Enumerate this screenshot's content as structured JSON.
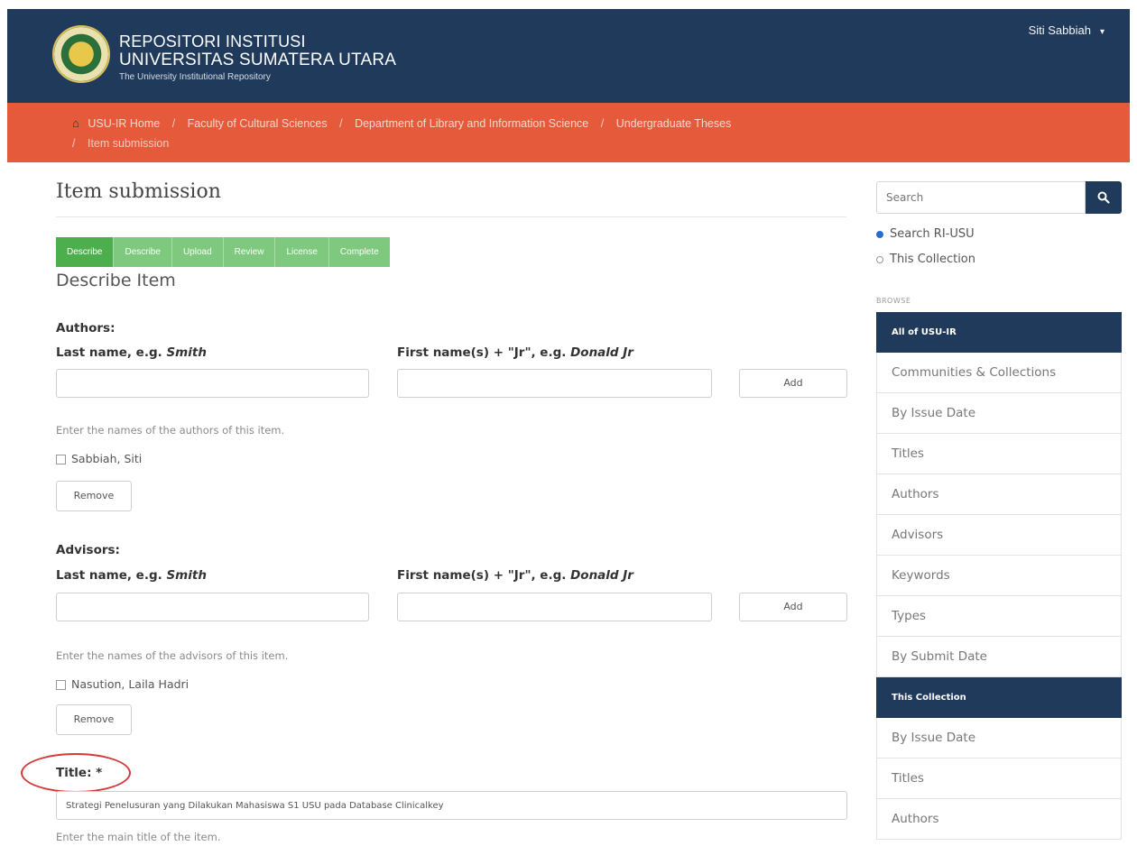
{
  "header": {
    "brand_line1": "REPOSITORI INSTITUSI",
    "brand_line2": "UNIVERSITAS SUMATERA UTARA",
    "brand_line3": "The University Institutional Repository",
    "user_name": "Siti Sabbiah",
    "user_caret": "▾"
  },
  "breadcrumb": {
    "items": [
      "USU-IR Home",
      "Faculty of Cultural Sciences",
      "Department of Library and Information Science",
      "Undergraduate Theses",
      "Item submission"
    ],
    "separator": "/"
  },
  "main": {
    "page_title": "Item submission",
    "steps": [
      "Describe",
      "Describe",
      "Upload",
      "Review",
      "License",
      "Complete"
    ],
    "section_title": "Describe Item",
    "authors": {
      "heading": "Authors:",
      "last_label": "Last name, e.g.",
      "last_example": "Smith",
      "first_label": "First name(s) + \"Jr\", e.g.",
      "first_example": "Donald Jr",
      "last_value": "",
      "first_value": "",
      "add_label": "Add",
      "help": "Enter the names of the authors of this item.",
      "entry": "Sabbiah, Siti",
      "remove_label": "Remove"
    },
    "advisors": {
      "heading": "Advisors:",
      "last_label": "Last name, e.g.",
      "last_example": "Smith",
      "first_label": "First name(s) + \"Jr\", e.g.",
      "first_example": "Donald Jr",
      "last_value": "",
      "first_value": "",
      "add_label": "Add",
      "help": "Enter the names of the advisors of this item.",
      "entry": "Nasution, Laila Hadri",
      "remove_label": "Remove"
    },
    "title_field": {
      "label": "Title: *",
      "value": "Strategi Penelusuran yang Dilakukan Mahasiswa S1 USU pada Database Clinicalkey",
      "help": "Enter the main title of the item."
    }
  },
  "sidebar": {
    "search_placeholder": "Search",
    "scope_options": [
      "Search RI-USU",
      "This Collection"
    ],
    "selected_scope": "Search RI-USU",
    "browse_caption": "BROWSE",
    "groups": [
      {
        "heading": "All of USU-IR",
        "items": [
          "Communities & Collections",
          "By Issue Date",
          "Titles",
          "Authors",
          "Advisors",
          "Keywords",
          "Types",
          "By Submit Date"
        ]
      },
      {
        "heading": "This Collection",
        "items": [
          "By Issue Date",
          "Titles",
          "Authors"
        ]
      }
    ]
  },
  "colors": {
    "header_bg": "#203a5c",
    "breadcrumb_bg": "#e65a3c",
    "step_active": "#4cae4c",
    "step_inactive": "#7fc97f",
    "highlight_ellipse": "#d23a3a"
  },
  "icons": {
    "logo": "university-seal-icon",
    "home": "home-icon",
    "search": "search-icon",
    "dropdown": "chevron-down-icon"
  }
}
